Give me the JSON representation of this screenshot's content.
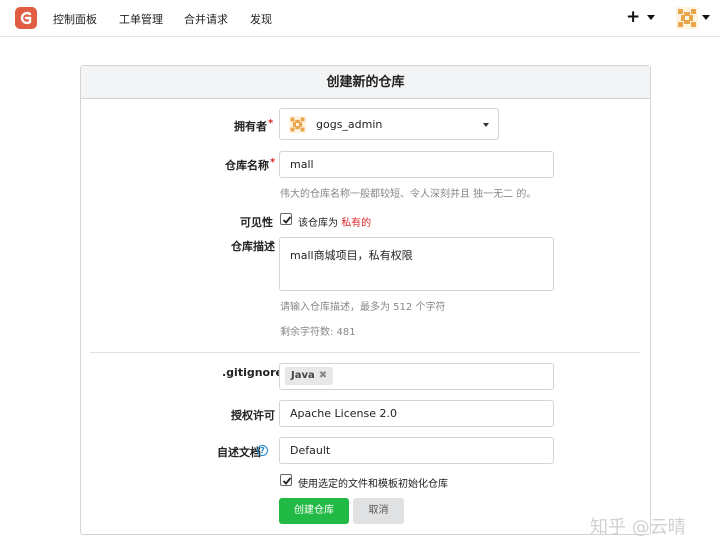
{
  "nav": {
    "items": [
      "控制面板",
      "工单管理",
      "合并请求",
      "发现"
    ],
    "plus": "+"
  },
  "panel": {
    "title": "创建新的仓库"
  },
  "form": {
    "owner_label": "拥有者",
    "owner_value": "gogs_admin",
    "repo_name_label": "仓库名称",
    "repo_name_value": "mall",
    "repo_name_help": "伟大的仓库名称一般都较短、令人深刻并且 独一无二 的。",
    "visibility_label": "可见性",
    "visibility_text": "该仓库为",
    "visibility_private": "私有的",
    "visibility_checked": true,
    "description_label": "仓库描述",
    "description_value": "mall商城项目，私有权限",
    "description_help": "请输入仓库描述，最多为 512 个字符",
    "remaining_label": "剩余字符数: 481",
    "gitignore_label": ".gitignore",
    "gitignore_tag": "Java",
    "gitignore_tag_remove": "✖",
    "license_label": "授权许可",
    "license_value": "Apache License 2.0",
    "readme_label": "自述文档",
    "readme_value": "Default",
    "init_label": "使用选定的文件和模板初始化仓库",
    "init_checked": true,
    "required_mark": "*",
    "help_q": "?"
  },
  "buttons": {
    "create": "创建仓库",
    "cancel": "取消"
  },
  "watermark": "知乎 @云晴",
  "colors": {
    "primary": "#21ba45",
    "required": "#db2828",
    "header_bg": "#f3f4f5",
    "logo": "#e05d44"
  }
}
